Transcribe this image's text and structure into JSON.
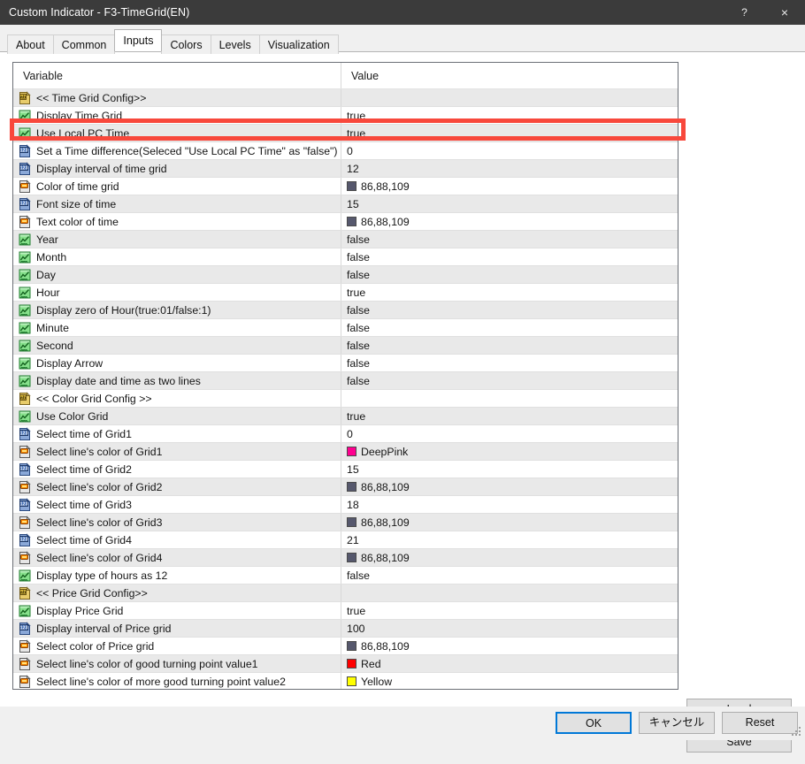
{
  "window": {
    "title": "Custom Indicator - F3-TimeGrid(EN)",
    "help_label": "?",
    "close_label": "×"
  },
  "tabs": [
    {
      "label": "About",
      "active": false
    },
    {
      "label": "Common",
      "active": false
    },
    {
      "label": "Inputs",
      "active": true
    },
    {
      "label": "Colors",
      "active": false
    },
    {
      "label": "Levels",
      "active": false
    },
    {
      "label": "Visualization",
      "active": false
    }
  ],
  "grid": {
    "headers": {
      "variable": "Variable",
      "value": "Value"
    },
    "rows": [
      {
        "icon": "string-ab-icon",
        "label": "<< Time Grid Config>>",
        "value": "",
        "swatch": null
      },
      {
        "icon": "bool-chart-icon",
        "label": "Display Time Grid",
        "value": "true",
        "swatch": null
      },
      {
        "icon": "bool-chart-icon",
        "label": "Use Local PC Time",
        "value": "true",
        "swatch": null
      },
      {
        "icon": "int-123-icon",
        "label": "Set a Time difference(Seleced \"Use Local PC Time\" as \"false\")",
        "value": "0",
        "swatch": null
      },
      {
        "icon": "int-123-icon",
        "label": "Display interval of time grid",
        "value": "12",
        "swatch": null
      },
      {
        "icon": "color-icon",
        "label": "Color of time grid",
        "value": "86,88,109",
        "swatch": "#56586d"
      },
      {
        "icon": "int-123-icon",
        "label": "Font size of time",
        "value": "15",
        "swatch": null
      },
      {
        "icon": "color-icon",
        "label": "Text color of time",
        "value": "86,88,109",
        "swatch": "#56586d"
      },
      {
        "icon": "bool-chart-icon",
        "label": "Year",
        "value": "false",
        "swatch": null
      },
      {
        "icon": "bool-chart-icon",
        "label": "Month",
        "value": "false",
        "swatch": null
      },
      {
        "icon": "bool-chart-icon",
        "label": "Day",
        "value": "false",
        "swatch": null
      },
      {
        "icon": "bool-chart-icon",
        "label": "Hour",
        "value": "true",
        "swatch": null
      },
      {
        "icon": "bool-chart-icon",
        "label": "Display zero of Hour(true:01/false:1)",
        "value": "false",
        "swatch": null
      },
      {
        "icon": "bool-chart-icon",
        "label": "Minute",
        "value": "false",
        "swatch": null
      },
      {
        "icon": "bool-chart-icon",
        "label": "Second",
        "value": "false",
        "swatch": null
      },
      {
        "icon": "bool-chart-icon",
        "label": "Display Arrow",
        "value": "false",
        "swatch": null
      },
      {
        "icon": "bool-chart-icon",
        "label": "Display date and time as two lines",
        "value": "false",
        "swatch": null
      },
      {
        "icon": "string-ab-icon",
        "label": "<< Color Grid Config >>",
        "value": "",
        "swatch": null
      },
      {
        "icon": "bool-chart-icon",
        "label": "Use Color Grid",
        "value": "true",
        "swatch": null
      },
      {
        "icon": "int-123-icon",
        "label": "Select time of Grid1",
        "value": "0",
        "swatch": null
      },
      {
        "icon": "color-icon",
        "label": "Select line's color of Grid1",
        "value": "DeepPink",
        "swatch": "#ff0090"
      },
      {
        "icon": "int-123-icon",
        "label": "Select time of Grid2",
        "value": "15",
        "swatch": null
      },
      {
        "icon": "color-icon",
        "label": "Select line's color of Grid2",
        "value": "86,88,109",
        "swatch": "#56586d"
      },
      {
        "icon": "int-123-icon",
        "label": "Select time of Grid3",
        "value": "18",
        "swatch": null
      },
      {
        "icon": "color-icon",
        "label": "Select line's color of Grid3",
        "value": "86,88,109",
        "swatch": "#56586d"
      },
      {
        "icon": "int-123-icon",
        "label": "Select time of Grid4",
        "value": "21",
        "swatch": null
      },
      {
        "icon": "color-icon",
        "label": "Select line's color of Grid4",
        "value": "86,88,109",
        "swatch": "#56586d"
      },
      {
        "icon": "bool-chart-icon",
        "label": "Display type of hours as 12",
        "value": "false",
        "swatch": null
      },
      {
        "icon": "string-ab-icon",
        "label": "<< Price Grid Config>>",
        "value": "",
        "swatch": null
      },
      {
        "icon": "bool-chart-icon",
        "label": "Display Price Grid",
        "value": "true",
        "swatch": null
      },
      {
        "icon": "int-123-icon",
        "label": "Display interval of Price grid",
        "value": "100",
        "swatch": null
      },
      {
        "icon": "color-icon",
        "label": "Select color of Price grid",
        "value": "86,88,109",
        "swatch": "#56586d"
      },
      {
        "icon": "color-icon",
        "label": "Select line's color of good turning point value1",
        "value": "Red",
        "swatch": "#ff0000"
      },
      {
        "icon": "color-icon",
        "label": "Select line's color of more good turning point value2",
        "value": "Yellow",
        "swatch": "#ffff00"
      }
    ]
  },
  "side_buttons": {
    "load": "Load",
    "save": "Save"
  },
  "footer_buttons": {
    "ok": "OK",
    "cancel": "キャンセル",
    "reset": "Reset"
  },
  "annotation": {
    "highlight_color": "#f8483c",
    "highlighted_row_label": "Use Local PC Time"
  }
}
